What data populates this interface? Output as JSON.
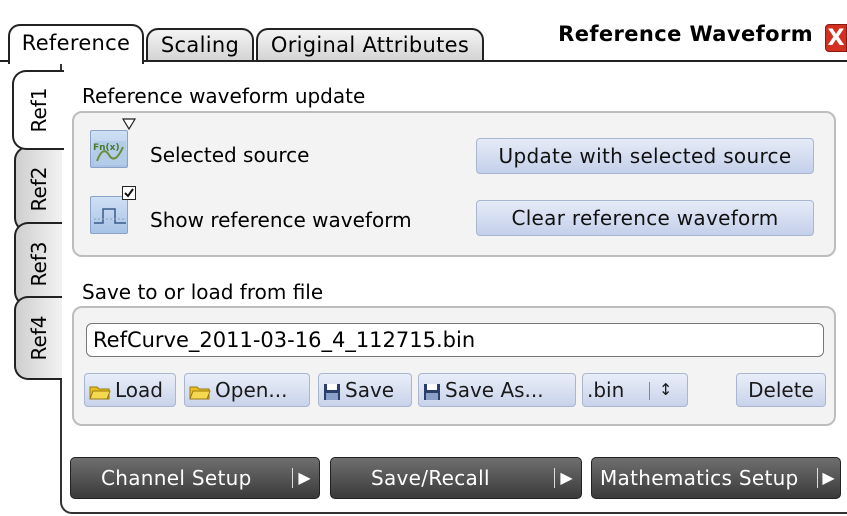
{
  "window": {
    "title": "Reference Waveform",
    "close_label": "X"
  },
  "top_tabs": [
    {
      "label": "Reference",
      "active": true
    },
    {
      "label": "Scaling",
      "active": false
    },
    {
      "label": "Original Attributes",
      "active": false
    }
  ],
  "side_tabs": [
    {
      "label": "Ref1",
      "active": true
    },
    {
      "label": "Ref2",
      "active": false
    },
    {
      "label": "Ref3",
      "active": false
    },
    {
      "label": "Ref4",
      "active": false
    }
  ],
  "update_section": {
    "title": "Reference waveform update",
    "selected_source_label": "Selected source",
    "selected_source_icon_text": "Fn(x)",
    "show_reference_label": "Show reference waveform",
    "show_reference_checked": true,
    "update_button": "Update with selected source",
    "clear_button": "Clear reference waveform"
  },
  "file_section": {
    "title": "Save to or load from file",
    "filename": "RefCurve_2011-03-16_4_112715.bin",
    "load_button": "Load",
    "open_button": "Open...",
    "save_button": "Save",
    "save_as_button": "Save As...",
    "format_value": ".bin",
    "format_arrows": "↕",
    "delete_button": "Delete"
  },
  "bottom_bar": {
    "channel_setup": "Channel Setup",
    "save_recall": "Save/Recall",
    "math_setup": "Mathematics Setup"
  },
  "colors": {
    "button_blue": "#c4d0ea",
    "dark_button": "#3a3a3a",
    "close_red": "#d23020",
    "folder_yellow": "#e8c020"
  }
}
